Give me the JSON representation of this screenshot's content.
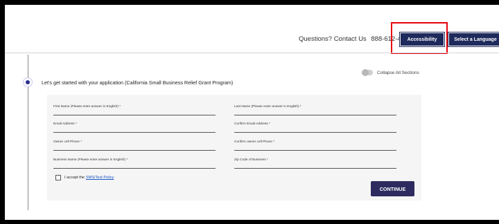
{
  "header": {
    "contact_text": "Questions? Contact Us",
    "phone": "888-612-4370",
    "accessibility_label": "Accessibility",
    "language_label": "Select a Language"
  },
  "section": {
    "collapse_label": "Collapse All Sections",
    "title": "Let's get started with your application  (California Small Business Relief Grant Program)"
  },
  "form": {
    "fields": [
      {
        "label": "First Name (Please enter answer in English) *"
      },
      {
        "label": "Last Name (Please enter answer in English) *"
      },
      {
        "label": "Email Address *"
      },
      {
        "label": "Confirm Email Address *"
      },
      {
        "label": "Owner cell Phone *"
      },
      {
        "label": "Confirm owner cell Phone *"
      },
      {
        "label": "Business Name (Please enter answer in English) *"
      },
      {
        "label": "Zip Code of Business *"
      }
    ],
    "checkbox_text": "I accept the",
    "checkbox_link": "SMS/Text Policy",
    "continue_label": "CONTINUE"
  },
  "colors": {
    "button_navy": "#1f2a5c",
    "continue_purple": "#2d2a5f",
    "highlight_red": "#e8000b",
    "link_blue": "#1a54c4"
  }
}
